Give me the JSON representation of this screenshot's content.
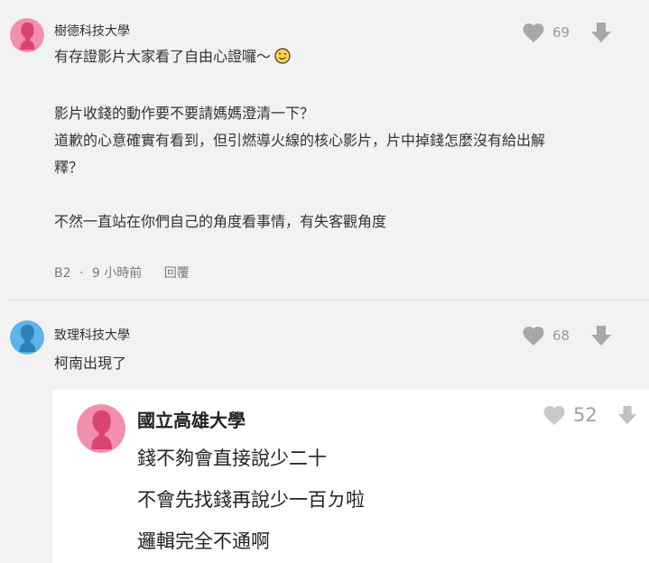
{
  "comments": [
    {
      "school": "樹德科技大學",
      "avatar": "female-avatar-icon",
      "avatar_color": "#f38fae",
      "likes": "69",
      "lines": [
        "有存證影片大家看了自由心證囉～",
        "",
        "影片收錢的動作要不要請媽媽澄清一下？",
        "道歉的心意確實有看到，但引燃導火線的核心影片，片中掉錢怎麼沒有給出解",
        "釋？",
        "",
        "不然一直站在你們自己的角度看事情，有失客觀角度"
      ],
      "emoji": "wink-emoji-icon",
      "floor": "B2",
      "separator": "·",
      "time": "9 小時前",
      "reply_label": "回覆"
    },
    {
      "school": "致理科技大學",
      "avatar": "male-avatar-icon",
      "avatar_color": "#5ab6e8",
      "likes": "68",
      "lines": [
        "柯南出現了"
      ]
    }
  ],
  "quoted": {
    "school": "國立高雄大學",
    "avatar": "female-avatar-icon",
    "avatar_color": "#f38fae",
    "likes": "52",
    "lines": [
      "錢不夠會直接說少二十",
      "不會先找錢再說少一百ㄉ啦",
      "邏輯完全不通啊"
    ]
  },
  "icons": {
    "like": "heart-icon",
    "dislike": "arrow-down-icon"
  },
  "colors": {
    "icon_gray": "#a8a8a8",
    "meta_gray": "#7b7b7b",
    "page_bg": "#f2f2f2",
    "quote_bg": "#ffffff"
  }
}
